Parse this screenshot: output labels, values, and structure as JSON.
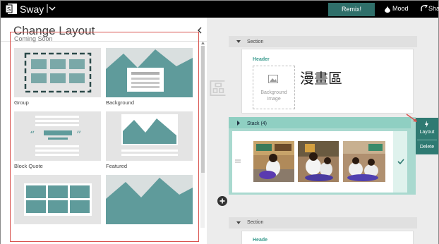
{
  "topbar": {
    "app_name": "Sway",
    "remix_label": "Remix!",
    "mood_label": "Mood",
    "share_label": "Sha"
  },
  "panel": {
    "title": "Change Layout",
    "section_label": "Coming Soon",
    "layouts": [
      {
        "label": "Group"
      },
      {
        "label": "Background"
      },
      {
        "label": "Block Quote"
      },
      {
        "label": "Featured"
      },
      {
        "label": ""
      },
      {
        "label": ""
      }
    ]
  },
  "canvas": {
    "sections": [
      {
        "label": "Section"
      },
      {
        "label": "Section"
      }
    ],
    "header_label": "Header",
    "header_label_2": "Heade",
    "background_image_text": "Background Image",
    "heading_text": "漫畫區",
    "stack_label": "Stack (4)",
    "context_menu": [
      {
        "label": "Layout",
        "icon": "lightning-icon"
      },
      {
        "label": "Delete"
      }
    ]
  },
  "colors": {
    "accent": "#2f6f6a",
    "stack": "#a9d9cf",
    "selection_border": "#d9534f"
  }
}
